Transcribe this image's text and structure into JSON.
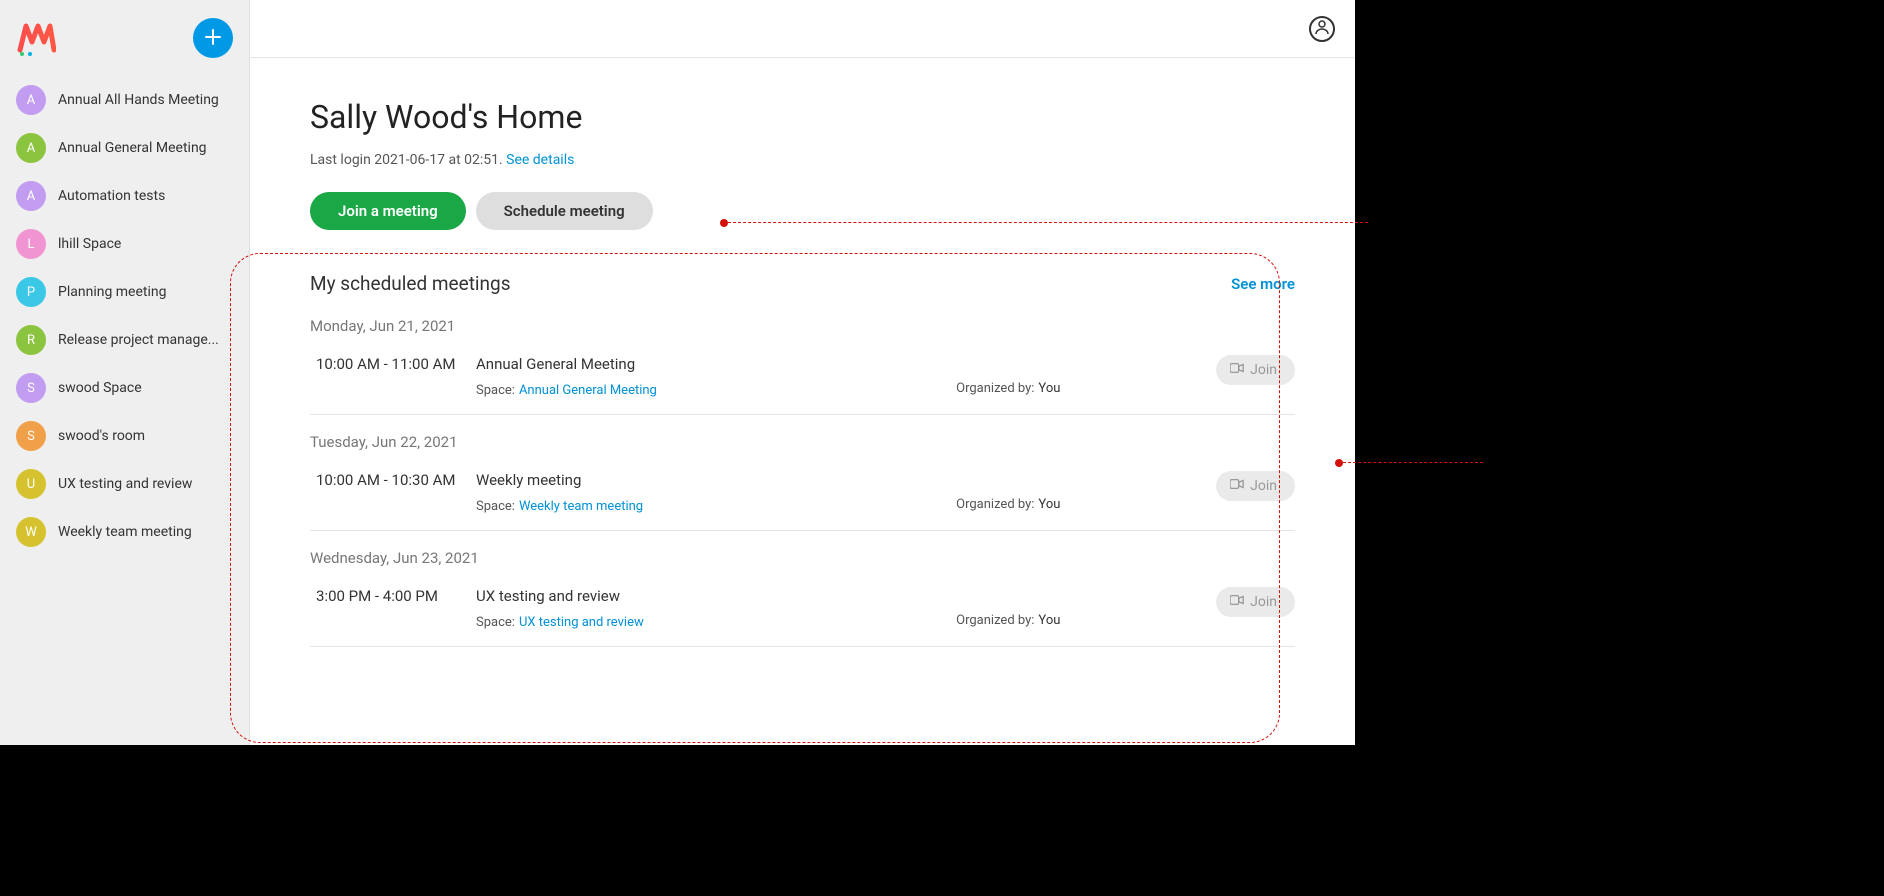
{
  "sidebar": {
    "items": [
      {
        "letter": "A",
        "label": "Annual All Hands Meeting",
        "color": "#c29cf0"
      },
      {
        "letter": "A",
        "label": "Annual General Meeting",
        "color": "#8bc53f"
      },
      {
        "letter": "A",
        "label": "Automation tests",
        "color": "#c29cf0"
      },
      {
        "letter": "L",
        "label": "lhill Space",
        "color": "#f095d2"
      },
      {
        "letter": "P",
        "label": "Planning meeting",
        "color": "#3bc8e6"
      },
      {
        "letter": "R",
        "label": "Release project manage...",
        "color": "#8bc53f"
      },
      {
        "letter": "S",
        "label": "swood Space",
        "color": "#c29cf0"
      },
      {
        "letter": "S",
        "label": "swood's room",
        "color": "#f0a048"
      },
      {
        "letter": "U",
        "label": "UX testing and review",
        "color": "#d6c22f"
      },
      {
        "letter": "W",
        "label": "Weekly team meeting",
        "color": "#d6c22f"
      }
    ]
  },
  "header": {
    "title": "Sally Wood's Home",
    "last_login_prefix": "Last login 2021-06-17 at 02:51.",
    "see_details": "See details"
  },
  "actions": {
    "join": "Join a meeting",
    "schedule": "Schedule meeting"
  },
  "meetings_section": {
    "title": "My scheduled meetings",
    "see_more": "See more",
    "space_label": "Space:",
    "org_label": "Organized by:",
    "join_label": "Join"
  },
  "days": [
    {
      "label": "Monday, Jun 21, 2021",
      "meetings": [
        {
          "time": "10:00 AM - 11:00 AM",
          "title": "Annual General Meeting",
          "space": "Annual General Meeting",
          "organizer": "You"
        }
      ]
    },
    {
      "label": "Tuesday, Jun 22, 2021",
      "meetings": [
        {
          "time": "10:00 AM - 10:30 AM",
          "title": "Weekly meeting",
          "space": "Weekly team meeting",
          "organizer": "You"
        }
      ]
    },
    {
      "label": "Wednesday, Jun 23, 2021",
      "meetings": [
        {
          "time": "3:00 PM - 4:00 PM",
          "title": "UX testing and review",
          "space": "UX testing and review",
          "organizer": "You"
        }
      ]
    }
  ]
}
